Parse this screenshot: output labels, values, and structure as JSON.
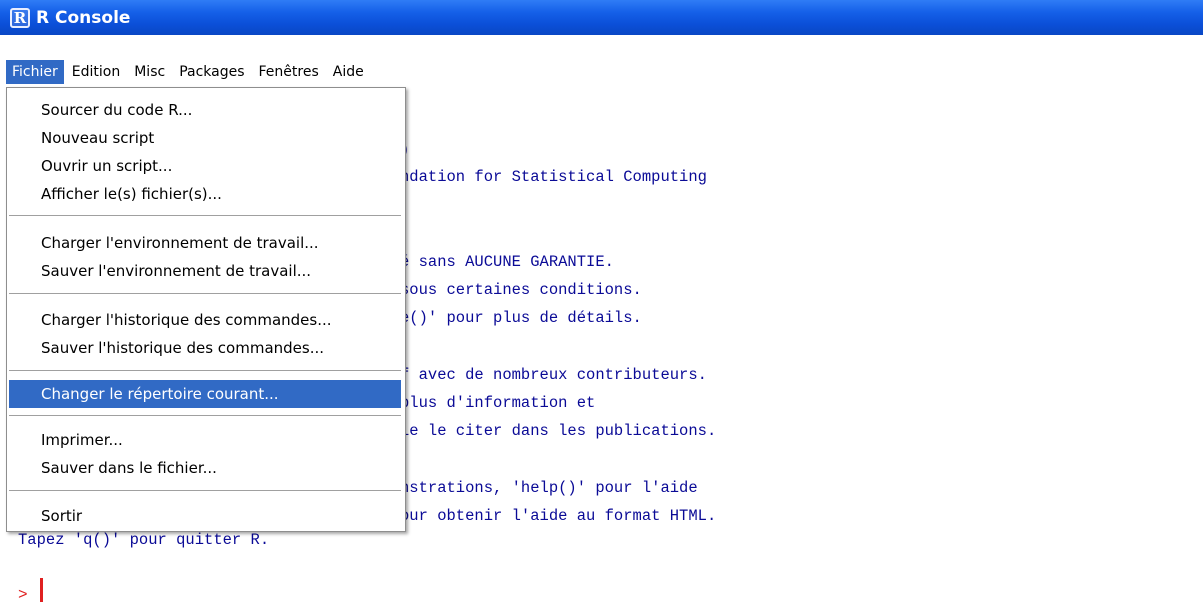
{
  "window": {
    "title": "R Console",
    "logo_letter": "R"
  },
  "menubar": {
    "items": [
      "Fichier",
      "Edition",
      "Misc",
      "Packages",
      "Fenêtres",
      "Aide"
    ]
  },
  "console": {
    "lines": [
      ")",
      "ndation for Statistical Computing",
      "é sans AUCUNE GARANTIE.",
      "sous certaines conditions.",
      "e()' pour plus de détails.",
      "f avec de nombreux contributeurs.",
      "plus d'information et",
      "le le citer dans les publications.",
      "nstrations, 'help()' pour l'aide",
      "our obtenir l'aide au format HTML.",
      "Tapez 'q()' pour quitter R."
    ],
    "prompt": ">"
  },
  "file_menu": {
    "items": [
      "Sourcer du code R...",
      "Nouveau script",
      "Ouvrir un script...",
      "Afficher le(s) fichier(s)...",
      "Charger l'environnement de travail...",
      "Sauver l'environnement de travail...",
      "Charger l'historique des commandes...",
      "Sauver l'historique des commandes...",
      "Changer le répertoire courant...",
      "Imprimer...",
      "Sauver dans le fichier...",
      "Sortir"
    ],
    "highlighted": "Changer le répertoire courant..."
  },
  "colors": {
    "titlebar": "#0a47c4",
    "menu_highlight": "#316ac5",
    "console_text": "#0a0a96",
    "prompt": "#e02020"
  }
}
